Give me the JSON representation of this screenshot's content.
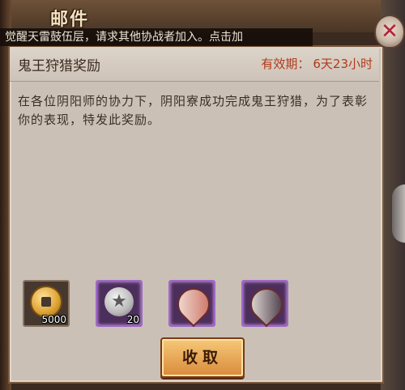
{
  "header": {
    "title": "邮件"
  },
  "ticker": {
    "text": "觉醒天雷鼓伍层，请求其他协战者加入。点击加"
  },
  "close": {
    "icon": "close-icon"
  },
  "mail": {
    "title": "鬼王狩猎奖励",
    "expiry_label": "有效期：",
    "expiry_value": "6天23小时",
    "body": "在各位阴阳师的协力下，阴阳寮成功完成鬼王狩猎，为了表彰你的表现，特发此奖励。"
  },
  "rewards": [
    {
      "icon": "gold-coin-icon",
      "count": "5000"
    },
    {
      "icon": "seal-medal-icon",
      "count": "20"
    },
    {
      "icon": "shikigami-card-icon-1",
      "count": ""
    },
    {
      "icon": "shikigami-card-icon-2",
      "count": ""
    }
  ],
  "actions": {
    "collect_label": "收取"
  }
}
